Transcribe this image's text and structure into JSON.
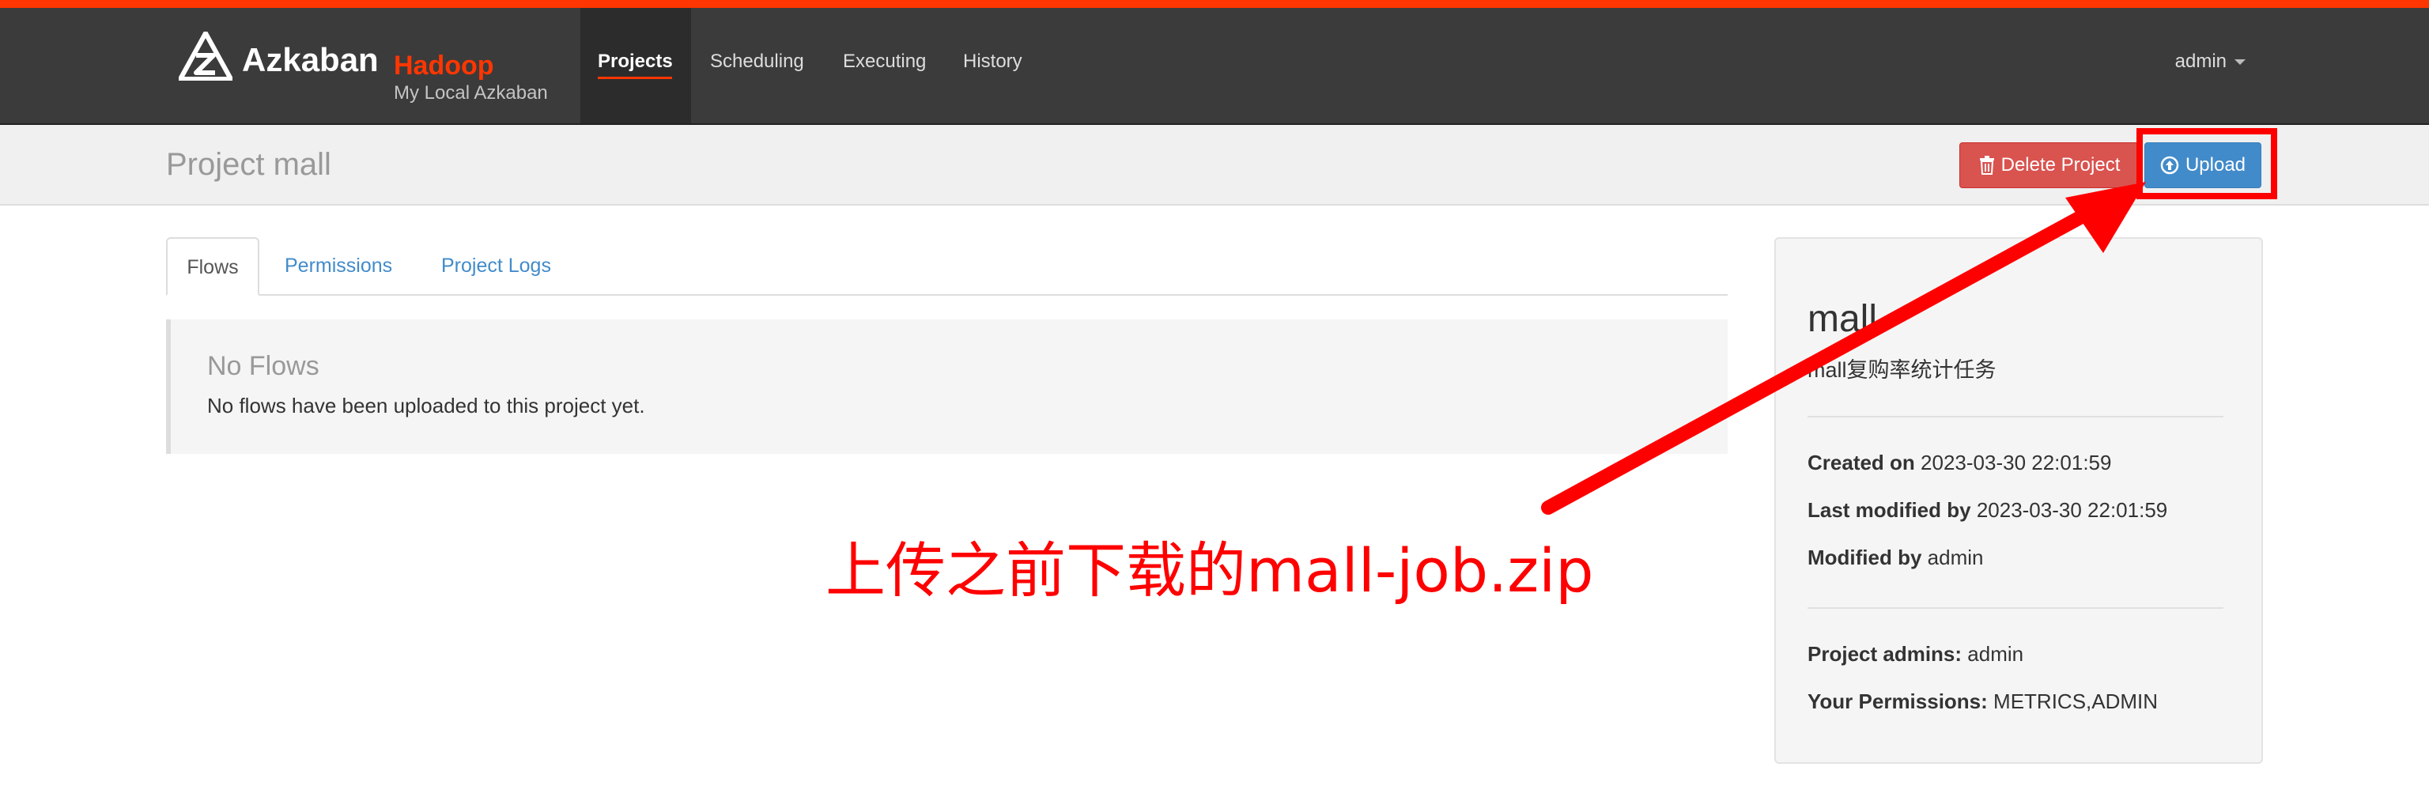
{
  "navbar": {
    "brand": "Azkaban",
    "brand_tag": "Hadoop",
    "brand_sub": "My Local Azkaban",
    "items": [
      {
        "label": "Projects"
      },
      {
        "label": "Scheduling"
      },
      {
        "label": "Executing"
      },
      {
        "label": "History"
      }
    ],
    "user": "admin"
  },
  "header": {
    "title": "Project mall",
    "delete_label": "Delete Project",
    "upload_label": "Upload"
  },
  "tabs": [
    {
      "label": "Flows"
    },
    {
      "label": "Permissions"
    },
    {
      "label": "Project Logs"
    }
  ],
  "flows": {
    "empty_title": "No Flows",
    "empty_text": "No flows have been uploaded to this project yet."
  },
  "project": {
    "name": "mall",
    "description": "mall复购率统计任务",
    "created_label": "Created on",
    "created_value": "2023-03-30 22:01:59",
    "last_modified_label": "Last modified by",
    "last_modified_value": "2023-03-30 22:01:59",
    "modified_by_label": "Modified by",
    "modified_by_value": "admin",
    "admins_label": "Project admins:",
    "admins_value": "admin",
    "permissions_label": "Your Permissions:",
    "permissions_value": "METRICS,ADMIN"
  },
  "annotation": {
    "text": "上传之前下载的mall-job.zip"
  },
  "colors": {
    "accent": "#ff3601",
    "navbar": "#3b3b3b",
    "delete": "#d9534f",
    "upload": "#428bca",
    "annotation": "#ff0000"
  },
  "icons": {
    "logo": "azkaban-logo-icon",
    "trash": "trash-icon",
    "upload": "upload-circle-icon",
    "caret": "caret-down-icon"
  }
}
